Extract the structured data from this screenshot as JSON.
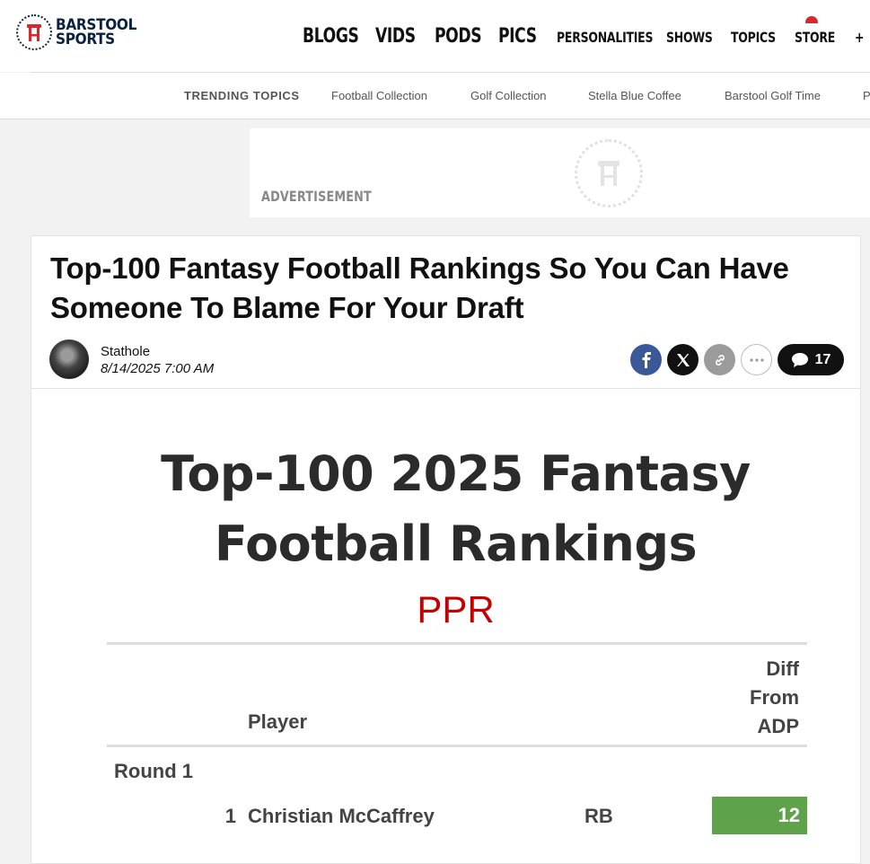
{
  "brand": {
    "line1": "BARSTOOL",
    "line2": "SPORTS"
  },
  "nav": [
    "BLOGS",
    "VIDS",
    "PODS",
    "PICS",
    "PERSONALITIES",
    "SHOWS",
    "TOPICS",
    "STORE",
    "+"
  ],
  "trending": {
    "label": "TRENDING TOPICS",
    "items": [
      "Football Collection",
      "Golf Collection",
      "Stella Blue Coffee",
      "Barstool Golf Time",
      "P"
    ]
  },
  "ad": {
    "label": "ADVERTISEMENT"
  },
  "article": {
    "title": "Top-100 Fantasy Football Rankings So You Can Have Someone To Blame For Your Draft",
    "author": "Stathole",
    "date": "8/14/2025 7:00 AM",
    "comment_count": "17"
  },
  "rankings": {
    "title_line1": "Top-100 2025 Fantasy",
    "title_line2": "Football Rankings",
    "format": "PPR",
    "col_player": "Player",
    "col_diff": [
      "Diff",
      "From",
      "ADP"
    ],
    "round_label": "Round 1",
    "rows": [
      {
        "rank": "1",
        "name": "Christian McCaffrey",
        "pos": "RB",
        "diff": "12"
      }
    ]
  },
  "colors": {
    "brand_navy": "#0a2240",
    "ppr_red": "#c40000",
    "diff_green": "#5ea24a",
    "facebook": "#3b5998"
  }
}
